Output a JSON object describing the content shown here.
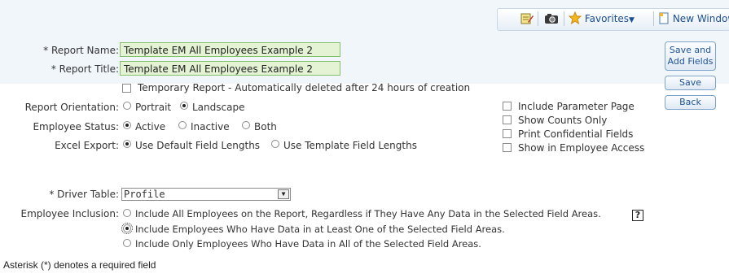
{
  "toolbar": {
    "favorites_label": "Favorites",
    "new_window_label": "New Window"
  },
  "form": {
    "report_name": {
      "label": "* Report Name:",
      "value": "Template EM All Employees Example 2"
    },
    "report_title": {
      "label": "* Report Title:",
      "value": "Template EM All Employees Example 2"
    },
    "temporary_report_label": "Temporary Report - Automatically deleted after 24 hours of creation",
    "orientation": {
      "label": "Report Orientation:",
      "options": [
        "Portrait",
        "Landscape"
      ],
      "selected": "Landscape"
    },
    "employee_status": {
      "label": "Employee Status:",
      "options": [
        "Active",
        "Inactive",
        "Both"
      ],
      "selected": "Active"
    },
    "excel_export": {
      "label": "Excel Export:",
      "options": [
        "Use Default Field Lengths",
        "Use Template Field Lengths"
      ],
      "selected": "Use Default Field Lengths"
    },
    "options_checkboxes": [
      "Include Parameter Page",
      "Show Counts Only",
      "Print Confidential Fields",
      "Show in Employee Access"
    ],
    "driver_table": {
      "label": "* Driver Table:",
      "value": "Profile"
    },
    "employee_inclusion": {
      "label": "Employee Inclusion:",
      "options": [
        "Include All Employees on the Report, Regardless if They Have Any Data in the Selected Field Areas.",
        "Include Employees Who Have Data in at Least One of the Selected Field Areas.",
        "Include Only Employees Who Have Data in All of the Selected Field Areas."
      ],
      "selected_index": 1
    },
    "help_label": "?"
  },
  "buttons": {
    "save_add_fields_line1": "Save and",
    "save_add_fields_line2": "Add Fields",
    "save": "Save",
    "back": "Back"
  },
  "footer": {
    "required_note": "Asterisk (*) denotes a required field"
  }
}
